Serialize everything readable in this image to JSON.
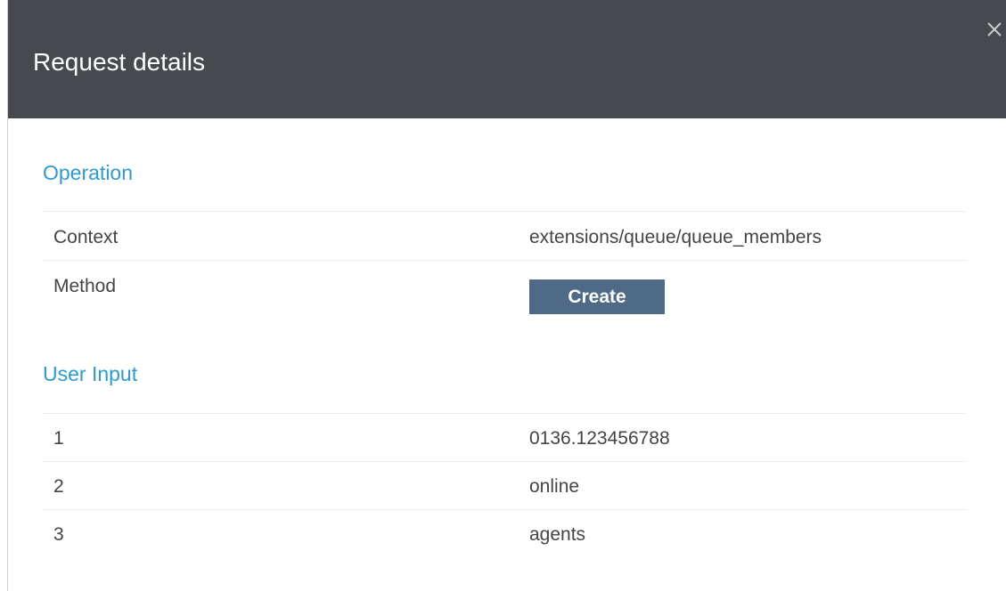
{
  "dialog": {
    "title": "Request details",
    "close_icon": "close-icon"
  },
  "operation": {
    "heading": "Operation",
    "rows": [
      {
        "label": "Context",
        "value": "extensions/queue/queue_members"
      },
      {
        "label": "Method",
        "value": "Create"
      }
    ]
  },
  "user_input": {
    "heading": "User Input",
    "rows": [
      {
        "label": "1",
        "value": "0136.123456788"
      },
      {
        "label": "2",
        "value": "online"
      },
      {
        "label": "3",
        "value": "agents"
      }
    ]
  },
  "colors": {
    "header_bg": "#464a4e",
    "section_heading": "#2b9bd0",
    "method_badge_bg": "#4e6a87"
  }
}
